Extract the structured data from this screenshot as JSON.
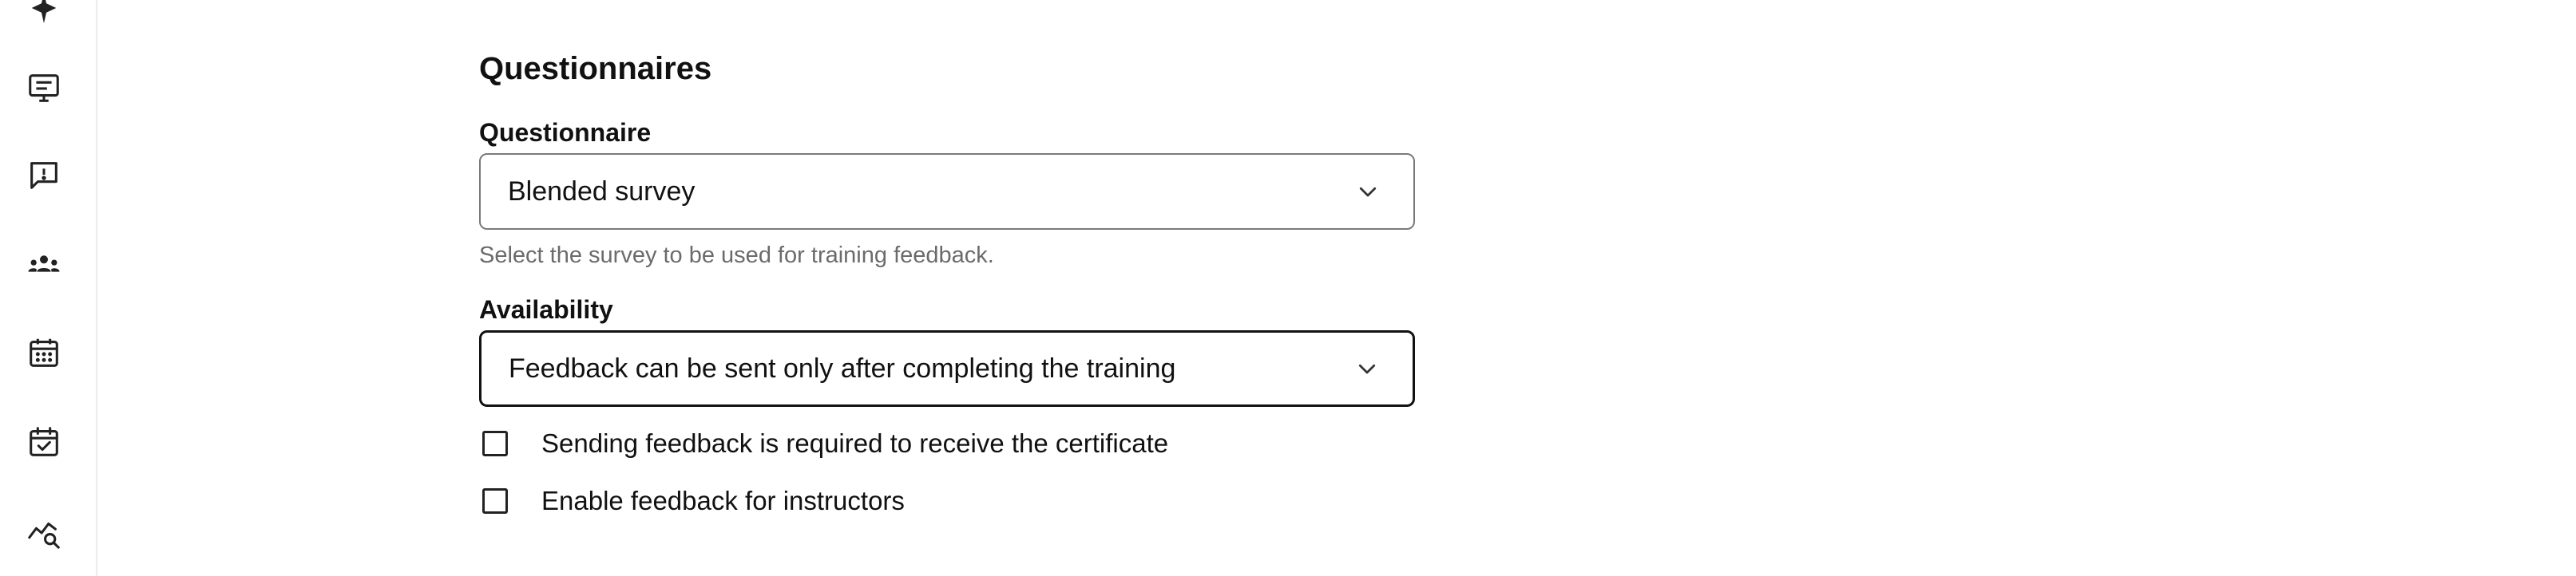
{
  "sidebar": {
    "items": [
      {
        "icon": "sparkle-icon"
      },
      {
        "icon": "presentation-list-icon"
      },
      {
        "icon": "feedback-alert-icon"
      },
      {
        "icon": "group-users-icon"
      },
      {
        "icon": "calendar-icon"
      },
      {
        "icon": "calendar-check-icon"
      },
      {
        "icon": "analytics-search-icon"
      }
    ]
  },
  "questionnaires": {
    "title": "Questionnaires",
    "questionnaire_label": "Questionnaire",
    "questionnaire_value": "Blended survey",
    "questionnaire_helper": "Select the survey to be used for training feedback.",
    "availability_label": "Availability",
    "availability_value": "Feedback can be sent only after completing the training",
    "checkboxes": [
      {
        "label": "Sending feedback is required to receive the certificate",
        "checked": false
      },
      {
        "label": "Enable feedback for instructors",
        "checked": false
      }
    ]
  }
}
